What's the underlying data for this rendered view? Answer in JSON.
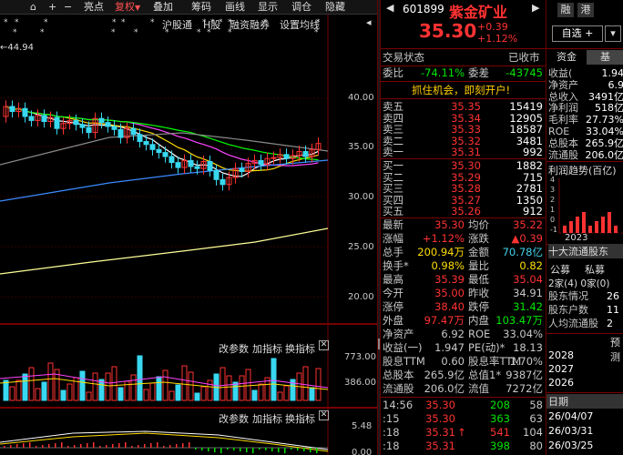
{
  "toolbar": {
    "items": [
      "⌂",
      "+",
      "−",
      "亮点",
      "复权",
      "叠加",
      "筹码",
      "画线",
      "显示",
      "调仓",
      "隐藏"
    ],
    "fuquan_arrow": "▼"
  },
  "subbar": {
    "items": [
      "沪股通",
      "H股",
      "融资融券",
      "设置均线"
    ],
    "more": "◂"
  },
  "chart_annotation": "←44.94",
  "price_axis": [
    "40.00",
    "35.00",
    "30.00",
    "25.00",
    "20.00"
  ],
  "vol_axis": [
    "773.00",
    "386.00"
  ],
  "macd_axis": [
    "5.48",
    "0.00"
  ],
  "indicator_links": [
    "改参数",
    "加指标",
    "换指标"
  ],
  "header": {
    "code": "601899",
    "name": "紫金矿业",
    "nav_prev": "◀",
    "nav_next": "▶",
    "tabs": [
      "融",
      "港"
    ],
    "price": "35.30",
    "change": "+0.39",
    "change_pct": "+1.12%",
    "add_btn": "自选 +",
    "more_btn": "▾"
  },
  "status": {
    "label": "交易状态",
    "value": "已收市"
  },
  "weibi": {
    "label1": "委比",
    "value1": "-74.11%",
    "label2": "委差",
    "value2": "-43745"
  },
  "ad": "抓住机会，即刻开户!",
  "sells": [
    {
      "label": "卖五",
      "price": "35.35",
      "vol": "15419"
    },
    {
      "label": "卖四",
      "price": "35.34",
      "vol": "12905"
    },
    {
      "label": "卖三",
      "price": "35.33",
      "vol": "18587"
    },
    {
      "label": "卖二",
      "price": "35.32",
      "vol": "3481"
    },
    {
      "label": "卖一",
      "price": "35.31",
      "vol": "992"
    }
  ],
  "buys": [
    {
      "label": "买一",
      "price": "35.30",
      "vol": "1882"
    },
    {
      "label": "买二",
      "price": "35.29",
      "vol": "715"
    },
    {
      "label": "买三",
      "price": "35.28",
      "vol": "2781"
    },
    {
      "label": "买四",
      "price": "35.27",
      "vol": "1350"
    },
    {
      "label": "买五",
      "price": "35.26",
      "vol": "912"
    }
  ],
  "stats": [
    [
      {
        "l": "最新",
        "v": "35.30",
        "c": "red"
      },
      {
        "l": "均价",
        "v": "35.22",
        "c": "red"
      }
    ],
    [
      {
        "l": "涨幅",
        "v": "+1.12%",
        "c": "red"
      },
      {
        "l": "涨跌",
        "v": "▲0.39",
        "c": "red"
      }
    ],
    [
      {
        "l": "总手",
        "v": "200.94万",
        "c": "yellow"
      },
      {
        "l": "金额",
        "v": "70.78亿",
        "c": "cyan"
      }
    ],
    [
      {
        "l": "换手*",
        "v": "0.98%",
        "c": "yellow"
      },
      {
        "l": "量比",
        "v": "0.82",
        "c": "yellow"
      }
    ],
    [
      {
        "l": "最高",
        "v": "35.39",
        "c": "red"
      },
      {
        "l": "最低",
        "v": "35.04",
        "c": "red"
      }
    ],
    [
      {
        "l": "今开",
        "v": "35.00",
        "c": "red"
      },
      {
        "l": "昨收",
        "v": "34.91",
        "c": "gray"
      }
    ],
    [
      {
        "l": "涨停",
        "v": "38.40",
        "c": "red"
      },
      {
        "l": "跌停",
        "v": "31.42",
        "c": "green"
      }
    ],
    [
      {
        "l": "外盘",
        "v": "97.47万",
        "c": "red"
      },
      {
        "l": "内盘",
        "v": "103.47万",
        "c": "green"
      }
    ],
    [
      {
        "l": "净资产",
        "v": "6.92",
        "c": "gray"
      },
      {
        "l": "ROE",
        "v": "33.04%",
        "c": "gray"
      }
    ],
    [
      {
        "l": "收益(一)",
        "v": "1.947",
        "c": "gray"
      },
      {
        "l": "PE(动)*",
        "v": "18.13",
        "c": "gray"
      }
    ],
    [
      {
        "l": "股息TTM",
        "v": "0.60",
        "c": "gray"
      },
      {
        "l": "股息率TTM",
        "v": "1.70%",
        "c": "gray"
      }
    ],
    [
      {
        "l": "总股本",
        "v": "265.9亿",
        "c": "gray"
      },
      {
        "l": "总值1*",
        "v": "9387亿",
        "c": "gray"
      }
    ],
    [
      {
        "l": "流通股",
        "v": "206.0亿",
        "c": "gray"
      },
      {
        "l": "流值",
        "v": "7272亿",
        "c": "gray"
      }
    ]
  ],
  "ticks": [
    {
      "t": "14:56",
      "p": "35.30",
      "v": "208",
      "n": "58"
    },
    {
      "t": ":15",
      "p": "35.30",
      "v": "363",
      "n": "63"
    },
    {
      "t": ":18",
      "p": "35.31",
      "v": "541",
      "n": "104",
      "up": "↑"
    },
    {
      "t": ":18",
      "p": "35.31",
      "v": "398",
      "n": "80"
    }
  ],
  "fund": {
    "tabs": [
      "资金",
      "基"
    ],
    "rows": [
      [
        "收益(",
        "1.94"
      ],
      [
        "净资产",
        "6.9"
      ],
      [
        "总收入",
        "3491亿"
      ],
      [
        "净利润",
        "518亿"
      ],
      [
        "毛利率",
        "27.73%"
      ],
      [
        "ROE",
        "33.04%"
      ],
      [
        "总股本",
        "265.9亿"
      ],
      [
        "流通股",
        "206.0亿"
      ]
    ],
    "trend_title": "利润趋势(百亿)",
    "trend_axis": [
      "4",
      "3",
      "2",
      "1",
      "0",
      "-1"
    ],
    "trend_year": "2023",
    "holders_title": "十大流通股东",
    "holder_tabs": [
      "公募",
      "私募"
    ],
    "holder_counts": "2家(4) 0家(0)",
    "holder_rows": [
      [
        "股东情况",
        "26"
      ],
      [
        "股东户数",
        "11"
      ],
      [
        "人均流通股",
        "2"
      ]
    ],
    "forecast": [
      "2028",
      "2027",
      "2026"
    ],
    "forecast_label": "预测",
    "date_header": "日期",
    "dates": [
      "26/04/07",
      "26/03/31",
      "26/03/25"
    ]
  }
}
